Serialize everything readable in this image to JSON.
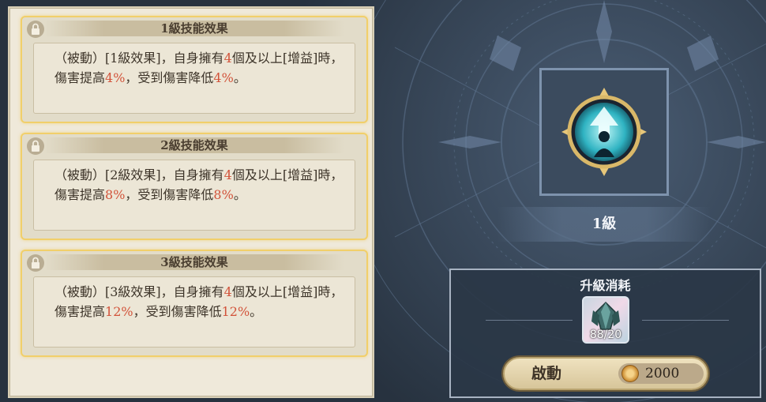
{
  "skill_levels": [
    {
      "title": "1級技能效果",
      "desc_part1": "（被動）[1級效果]，自身擁有",
      "count": "4",
      "desc_part2": "個及以上[增益]時，傷害提高",
      "dmg": "4%",
      "desc_part3": "，受到傷害降低",
      "reduce": "4%",
      "desc_end": "。"
    },
    {
      "title": "2級技能效果",
      "desc_part1": "（被動）[2級效果]，自身擁有",
      "count": "4",
      "desc_part2": "個及以上[增益]時，傷害提高",
      "dmg": "8%",
      "desc_part3": "，受到傷害降低",
      "reduce": "8%",
      "desc_end": "。"
    },
    {
      "title": "3級技能效果",
      "desc_part1": "（被動）[3級效果]，自身擁有",
      "count": "4",
      "desc_part2": "個及以上[增益]時，傷害提高",
      "dmg": "12%",
      "desc_part3": "，受到傷害降低",
      "reduce": "12%",
      "desc_end": "。"
    }
  ],
  "skill": {
    "icon": "ascend-figure-icon",
    "level_label": "1級"
  },
  "upgrade": {
    "title": "升級消耗",
    "material": {
      "icon": "crystal-material-icon",
      "count": "88/20"
    },
    "button_label": "啟動",
    "cost": "2000",
    "cost_icon": "gold-coin-icon"
  },
  "colors": {
    "highlight": "#d2533a",
    "card_border": "#f1cf6a"
  }
}
